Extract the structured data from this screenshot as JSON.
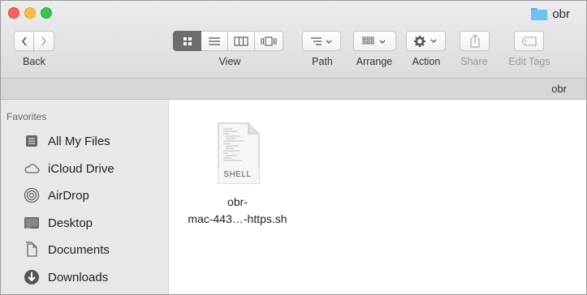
{
  "window": {
    "title": "obr"
  },
  "toolbar": {
    "back_label": "Back",
    "view_label": "View",
    "path_label": "Path",
    "arrange_label": "Arrange",
    "action_label": "Action",
    "share_label": "Share",
    "edit_tags_label": "Edit Tags"
  },
  "pathbar": {
    "crumb": "obr"
  },
  "sidebar": {
    "heading": "Favorites",
    "items": [
      {
        "label": "All My Files",
        "icon": "all-my-files-icon"
      },
      {
        "label": "iCloud Drive",
        "icon": "cloud-icon"
      },
      {
        "label": "AirDrop",
        "icon": "airdrop-icon"
      },
      {
        "label": "Desktop",
        "icon": "desktop-icon"
      },
      {
        "label": "Documents",
        "icon": "documents-icon"
      },
      {
        "label": "Downloads",
        "icon": "downloads-icon"
      }
    ]
  },
  "files": [
    {
      "name_line1": "obr-",
      "name_line2": "mac-443…-https.sh",
      "badge": "SHELL"
    }
  ],
  "colors": {
    "active_view": "#6d6d6d",
    "folder": "#6cc2f5"
  }
}
